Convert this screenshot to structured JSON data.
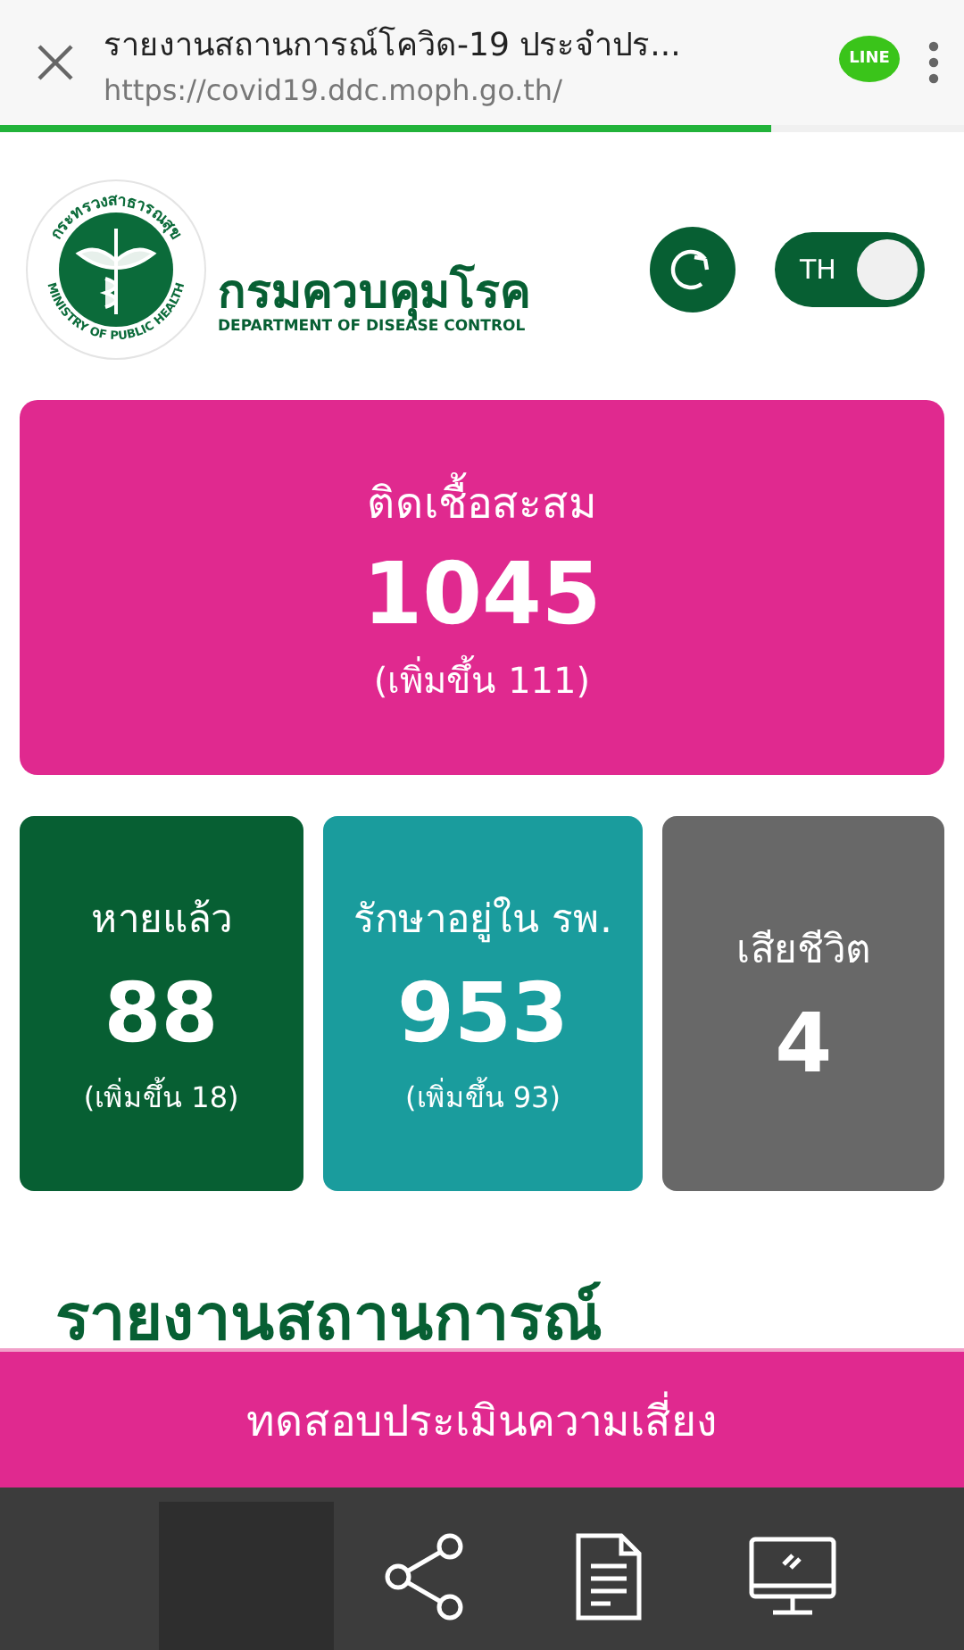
{
  "browser_bar": {
    "title": "รายงานสถานการณ์โควิด-19 ประจำปร...",
    "url": "https://covid19.ddc.moph.go.th/",
    "share_label": "LINE",
    "progress": {
      "level": 0.8
    }
  },
  "header": {
    "seal_top": "กระทรวงสาธารณสุข",
    "seal_bottom": "MINISTRY OF PUBLIC HEALTH",
    "org_name": "กรมควบคุมโรค",
    "org_name_en": "DEPARTMENT OF DISEASE CONTROL",
    "language_toggle": {
      "label": "TH",
      "on": true
    }
  },
  "summary": {
    "label": "ติดเชื้อสะสม",
    "value": "1045",
    "change": "(เพิ่มขึ้น 111)",
    "color": "#e0298f"
  },
  "stats": [
    {
      "label": "หายแล้ว",
      "value": "88",
      "change": "(เพิ่มขึ้น 18)",
      "color": "#075f33"
    },
    {
      "label": "รักษาอยู่ใน รพ.",
      "value": "953",
      "change": "(เพิ่มขึ้น 93)",
      "color": "#1a9c9d"
    },
    {
      "label": "เสียชีวิต",
      "value": "4",
      "color": "#686868"
    }
  ],
  "section_heading": "รายงานสถานการณ์",
  "action_button": "ทดสอบประเมินความเสี่ยง",
  "bottom_nav": [
    {
      "kind": "blank",
      "selected": true
    },
    {
      "kind": "share",
      "selected": false
    },
    {
      "kind": "document",
      "selected": false
    },
    {
      "kind": "monitor",
      "selected": false
    }
  ]
}
